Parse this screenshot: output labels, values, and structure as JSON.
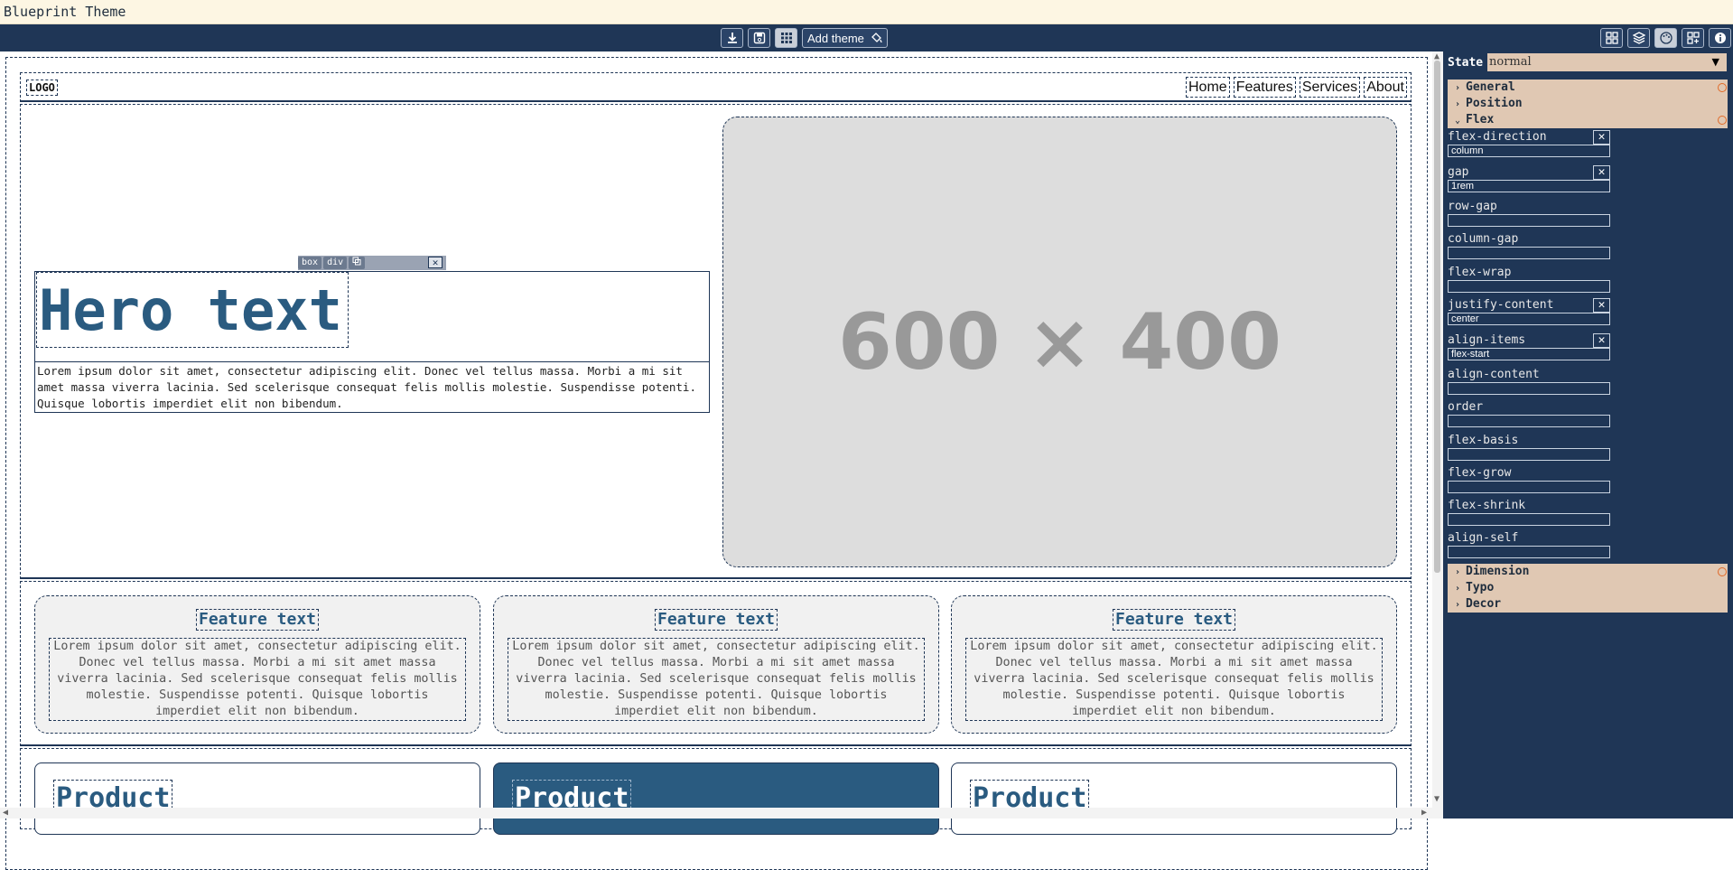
{
  "window": {
    "title": "Blueprint Theme"
  },
  "toolbar": {
    "add_theme_label": "Add theme",
    "center_icons": [
      "download-icon",
      "save-icon",
      "grid-icon"
    ],
    "right_icons": [
      "layout-icon",
      "layers-icon",
      "palette-icon",
      "add-block-icon",
      "info-icon"
    ]
  },
  "site": {
    "logo": "LOGO",
    "nav": [
      "Home",
      "Features",
      "Services",
      "About"
    ],
    "selection": {
      "chip1": "box",
      "chip2": "div"
    },
    "hero_title": "Hero text",
    "hero_desc": "Lorem ipsum dolor sit amet, consectetur adipiscing elit. Donec vel tellus massa. Morbi a mi sit amet massa viverra lacinia. Sed scelerisque consequat felis mollis molestie. Suspendisse potenti. Quisque lobortis imperdiet elit non bibendum.",
    "placeholder": "600 × 400",
    "features": [
      {
        "title": "Feature text",
        "desc": "Lorem ipsum dolor sit amet, consectetur adipiscing elit. Donec vel tellus massa. Morbi a mi sit amet massa viverra lacinia. Sed scelerisque consequat felis mollis molestie. Suspendisse potenti. Quisque lobortis imperdiet elit non bibendum."
      },
      {
        "title": "Feature text",
        "desc": "Lorem ipsum dolor sit amet, consectetur adipiscing elit. Donec vel tellus massa. Morbi a mi sit amet massa viverra lacinia. Sed scelerisque consequat felis mollis molestie. Suspendisse potenti. Quisque lobortis imperdiet elit non bibendum."
      },
      {
        "title": "Feature text",
        "desc": "Lorem ipsum dolor sit amet, consectetur adipiscing elit. Donec vel tellus massa. Morbi a mi sit amet massa viverra lacinia. Sed scelerisque consequat felis mollis molestie. Suspendisse potenti. Quisque lobortis imperdiet elit non bibendum."
      }
    ],
    "products": [
      "Product",
      "Product",
      "Product"
    ]
  },
  "panel": {
    "state_label": "State",
    "state_value": "normal",
    "sections_top": [
      "General",
      "Position",
      "Flex"
    ],
    "sections_bottom": [
      "Dimension",
      "Typo",
      "Decor"
    ],
    "flex_props": [
      {
        "label": "flex-direction",
        "value": "column"
      },
      {
        "label": "gap",
        "value": "1rem"
      },
      {
        "label": "row-gap",
        "value": ""
      },
      {
        "label": "column-gap",
        "value": ""
      },
      {
        "label": "flex-wrap",
        "value": ""
      },
      {
        "label": "justify-content",
        "value": "center"
      },
      {
        "label": "align-items",
        "value": "flex-start"
      },
      {
        "label": "align-content",
        "value": ""
      },
      {
        "label": "order",
        "value": ""
      },
      {
        "label": "flex-basis",
        "value": ""
      },
      {
        "label": "flex-grow",
        "value": ""
      },
      {
        "label": "flex-shrink",
        "value": ""
      },
      {
        "label": "align-self",
        "value": ""
      }
    ]
  },
  "colors": {
    "accent": "#2a5b80",
    "panel": "#1f3656",
    "section": "#e0c8b3",
    "modified_dot": "#e06b2a"
  }
}
